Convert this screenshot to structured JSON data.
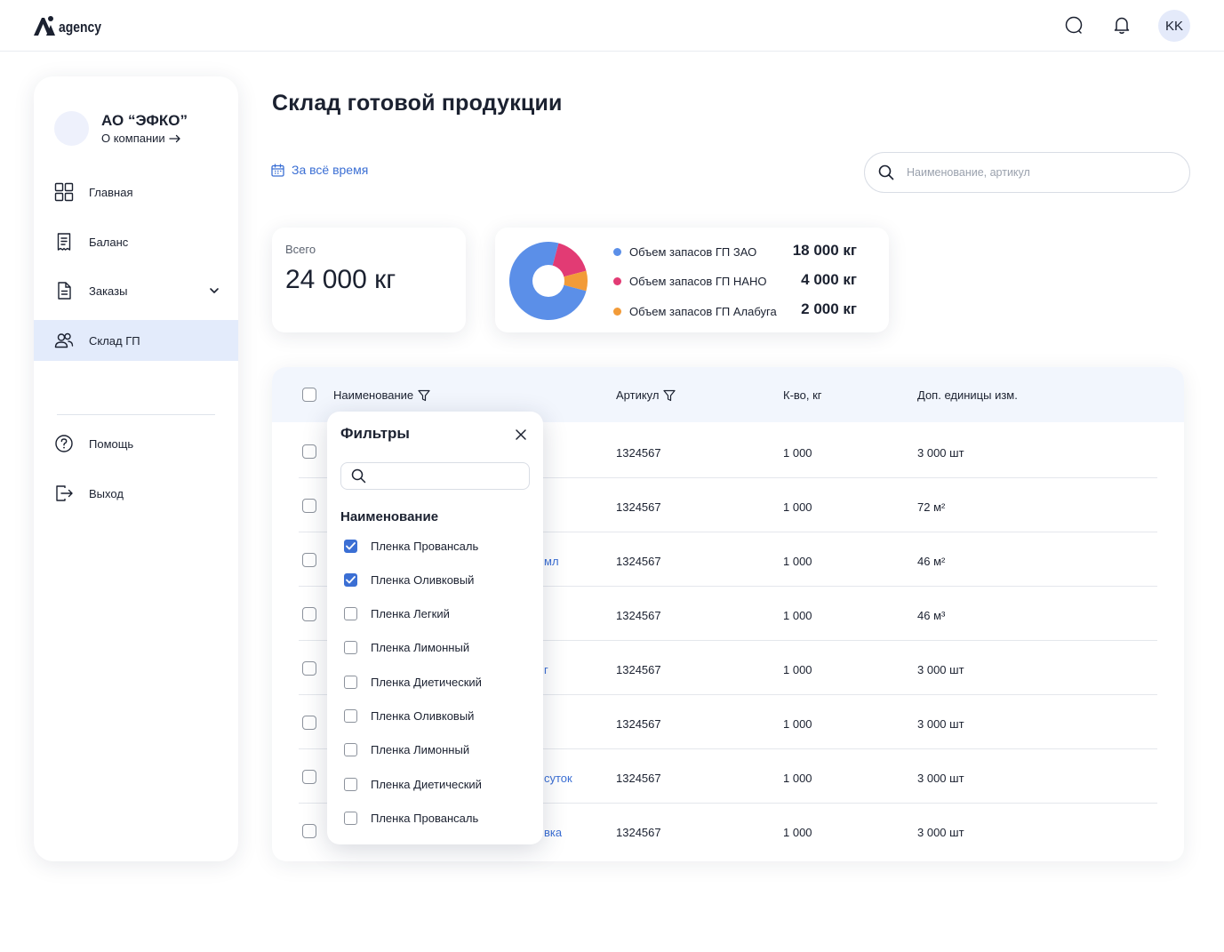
{
  "app": {
    "logo_text": "agency",
    "user_initials": "KK"
  },
  "sidebar": {
    "company_name": "АО “ЭФКО”",
    "company_link": "О компании",
    "items": [
      {
        "label": "Главная",
        "icon": "grid-icon"
      },
      {
        "label": "Баланс",
        "icon": "receipt-icon"
      },
      {
        "label": "Заказы",
        "icon": "document-icon"
      },
      {
        "label": "Склад ГП",
        "icon": "users-icon"
      }
    ],
    "active_item": "Склад ГП",
    "bottom_items": [
      {
        "label": "Помощь",
        "icon": "help-icon"
      },
      {
        "label": "Выход",
        "icon": "logout-icon"
      }
    ]
  },
  "main": {
    "title": "Склад готовой продукции",
    "date_filter": "За всё время",
    "search_placeholder": "Наименование, артикул"
  },
  "summary": {
    "total_label": "Всего",
    "total_value": "24 000 кг"
  },
  "chart_data": {
    "type": "pie",
    "categories": [
      "Объем запасов ГП ЗАО",
      "Объем запасов ГП НАНО",
      "Объем запасов ГП Алабуга"
    ],
    "values": [
      18000,
      4000,
      2000
    ],
    "value_labels": [
      "18 000 кг",
      "4 000 кг",
      "2 000 кг"
    ],
    "colors": [
      "#5b8fe8",
      "#e23b74",
      "#f29b38"
    ],
    "legend_position": "right"
  },
  "table": {
    "columns": [
      "Наименование",
      "Артикул",
      "К-во, кг",
      "Доп. единицы изм."
    ],
    "rows": [
      {
        "name": "",
        "article": "1324567",
        "qty": "1 000",
        "extra": "3 000 шт"
      },
      {
        "name": "",
        "article": "1324567",
        "qty": "1 000",
        "extra": "72 м²"
      },
      {
        "name": "мл",
        "article": "1324567",
        "qty": "1 000",
        "extra": "46 м²"
      },
      {
        "name": "",
        "article": "1324567",
        "qty": "1 000",
        "extra": "46 м³"
      },
      {
        "name": "г",
        "article": "1324567",
        "qty": "1 000",
        "extra": "3 000 шт"
      },
      {
        "name": "",
        "article": "1324567",
        "qty": "1 000",
        "extra": "3 000 шт"
      },
      {
        "name": "суток",
        "article": "1324567",
        "qty": "1 000",
        "extra": "3 000 шт"
      },
      {
        "name": "вка",
        "article": "1324567",
        "qty": "1 000",
        "extra": "3 000 шт"
      }
    ]
  },
  "filter_popup": {
    "title": "Фильтры",
    "section": "Наименование",
    "search_value": "",
    "options": [
      {
        "label": "Пленка Провансаль",
        "checked": true
      },
      {
        "label": "Пленка Оливковый",
        "checked": true
      },
      {
        "label": "Пленка Легкий",
        "checked": false
      },
      {
        "label": "Пленка Лимонный",
        "checked": false
      },
      {
        "label": "Пленка Диетический",
        "checked": false
      },
      {
        "label": "Пленка Оливковый",
        "checked": false
      },
      {
        "label": "Пленка Лимонный",
        "checked": false
      },
      {
        "label": "Пленка Диетический",
        "checked": false
      },
      {
        "label": "Пленка Провансаль",
        "checked": false
      }
    ]
  }
}
